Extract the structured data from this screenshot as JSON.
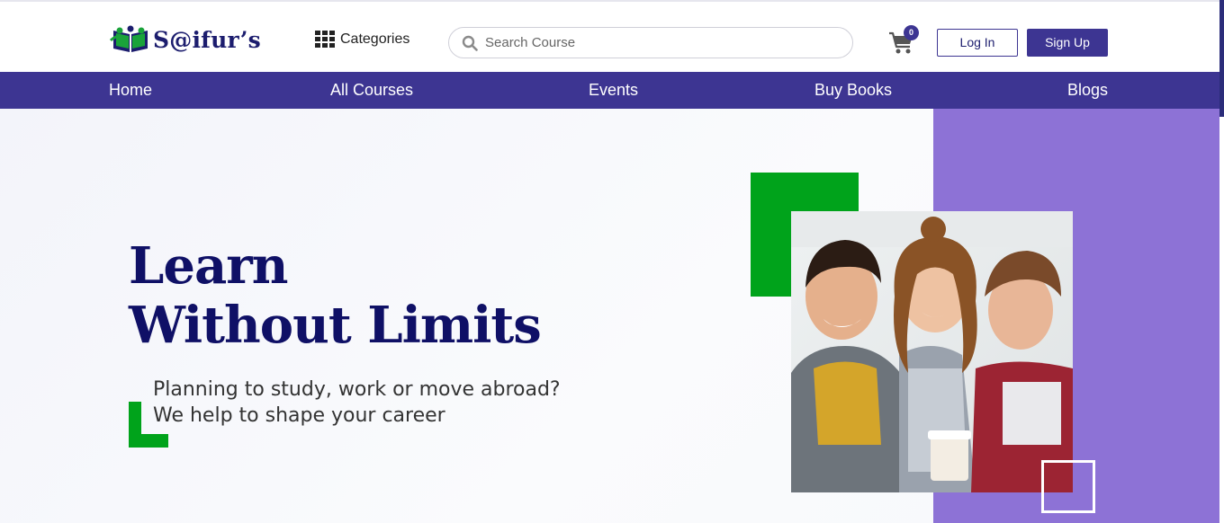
{
  "brand": {
    "name": "S@ifur’s"
  },
  "header": {
    "categories_label": "Categories",
    "search_placeholder": "Search Course",
    "cart_count": "0",
    "login_label": "Log In",
    "signup_label": "Sign Up"
  },
  "nav": {
    "items": [
      {
        "label": "Home"
      },
      {
        "label": "All Courses"
      },
      {
        "label": "Events"
      },
      {
        "label": "Buy Books"
      },
      {
        "label": "Blogs"
      }
    ]
  },
  "hero": {
    "title_line1": "Learn",
    "title_line2": "Without Limits",
    "subtitle_line1": "Planning to study, work or move abroad?",
    "subtitle_line2": "We help to shape your career"
  },
  "colors": {
    "brand_navy": "#1c1d6e",
    "nav_purple": "#3d3592",
    "accent_green": "#00a31b",
    "panel_lavender": "#8d72d6"
  }
}
